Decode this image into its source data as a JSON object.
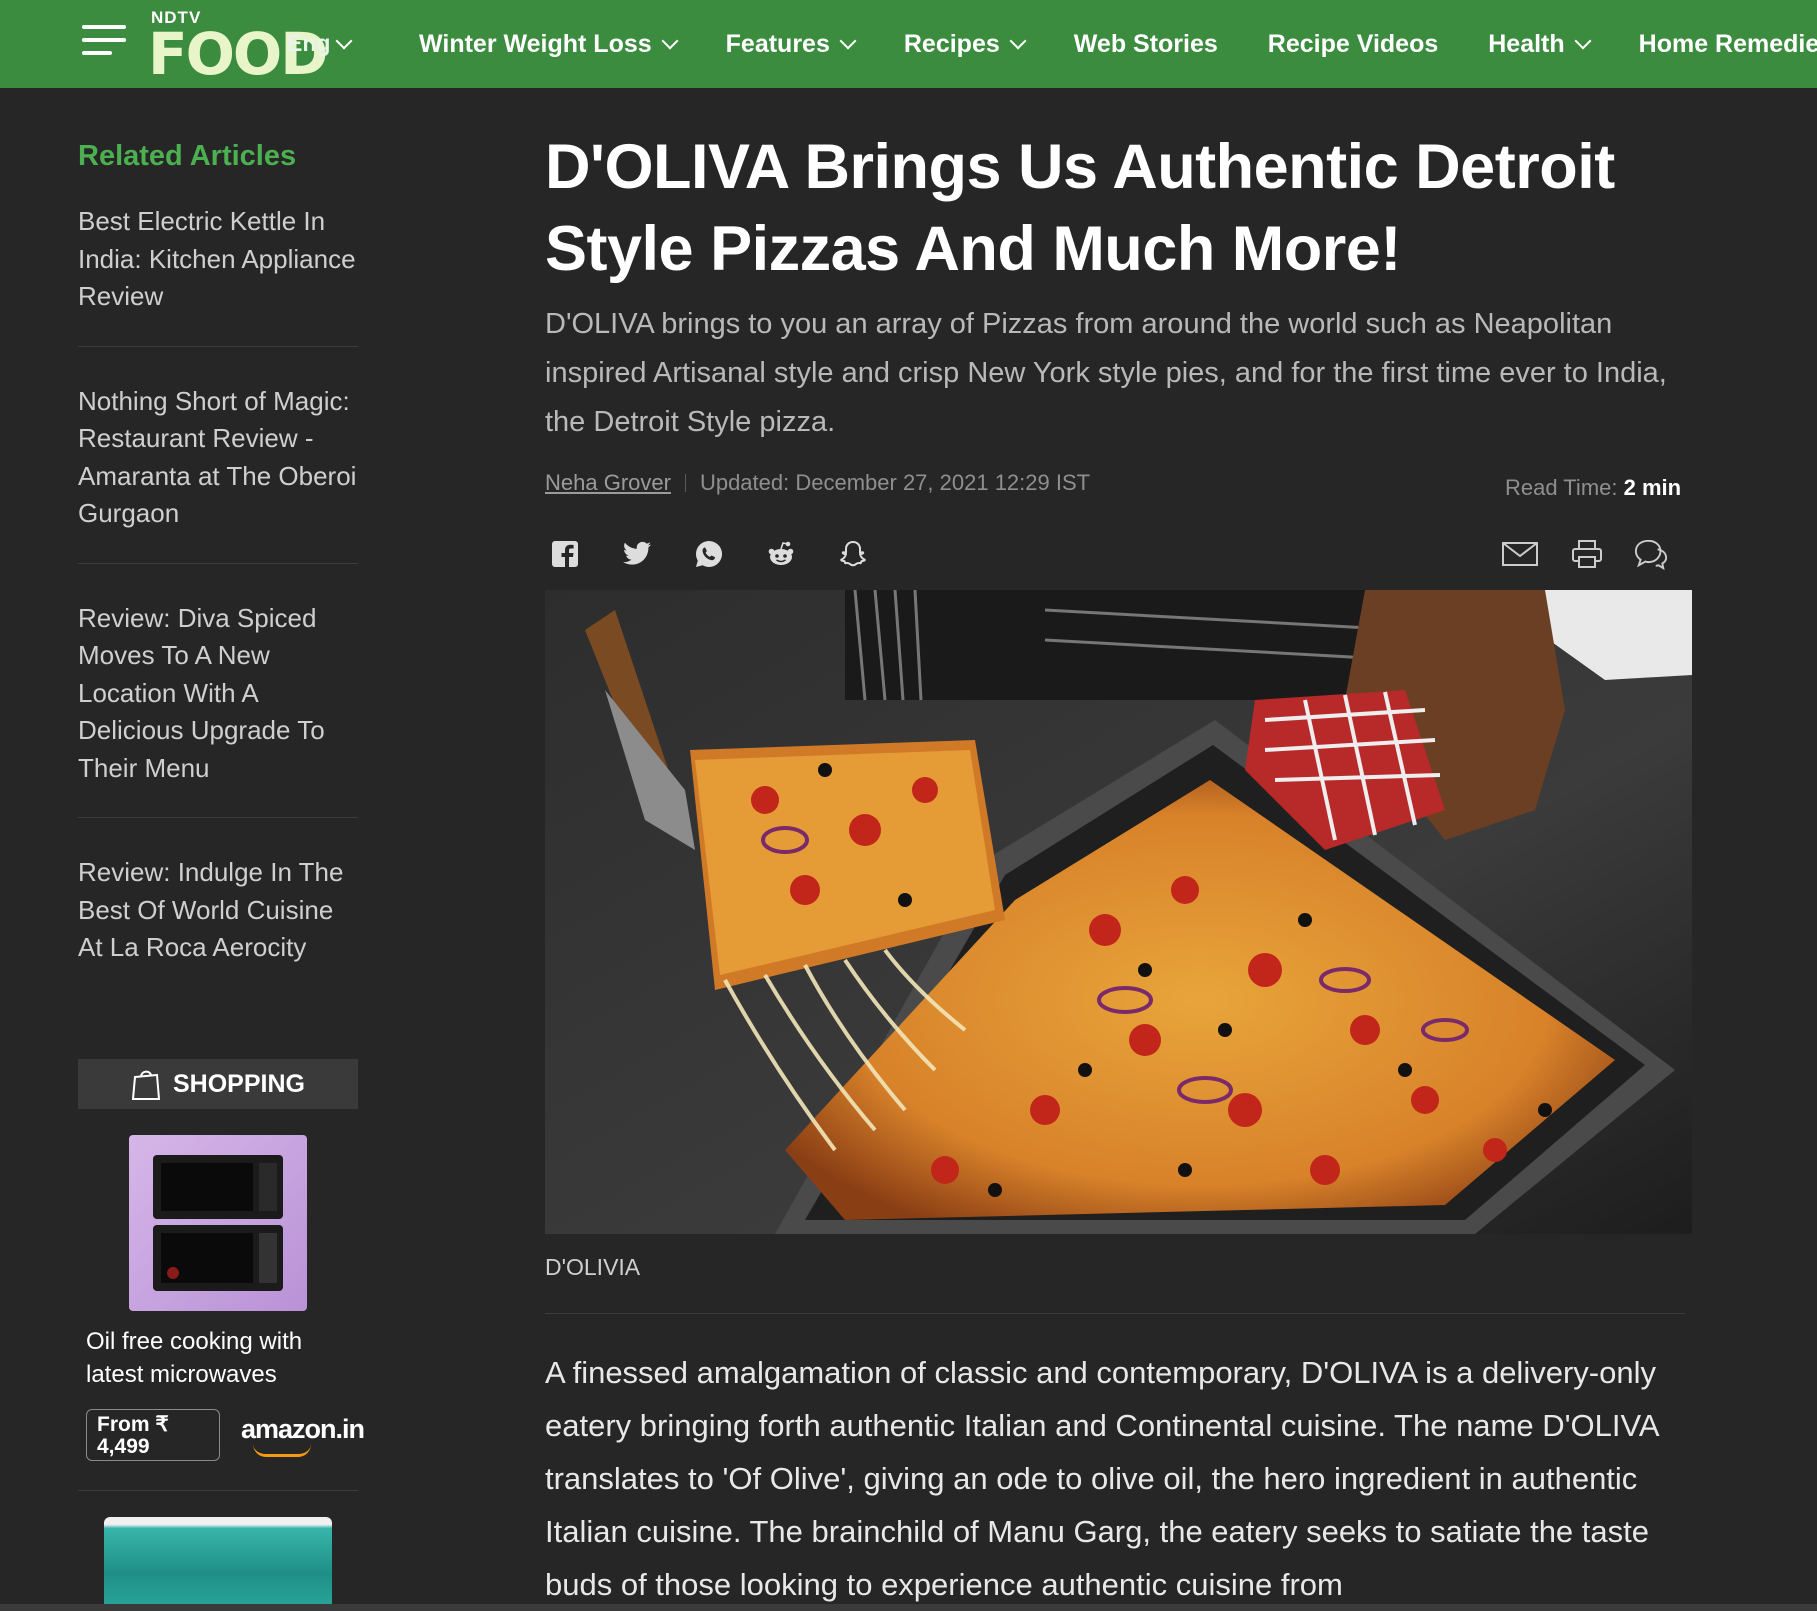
{
  "header": {
    "logo_small": "NDTV",
    "logo_big": "FOOD",
    "language": "Eng",
    "nav": [
      {
        "label": "Winter Weight Loss",
        "dropdown": true
      },
      {
        "label": "Features",
        "dropdown": true
      },
      {
        "label": "Recipes",
        "dropdown": true
      },
      {
        "label": "Web Stories",
        "dropdown": false
      },
      {
        "label": "Recipe Videos",
        "dropdown": false
      },
      {
        "label": "Health",
        "dropdown": true
      },
      {
        "label": "Home Remedies",
        "dropdown": false
      }
    ],
    "bg_color": "#3c8c3f"
  },
  "sidebar": {
    "heading": "Related Articles",
    "heading_color": "#4caf50",
    "items": [
      {
        "label": "Best Electric Kettle In India: Kitchen Appliance Review"
      },
      {
        "label": "Nothing Short of Magic: Restaurant Review - Amaranta at The Oberoi Gurgaon"
      },
      {
        "label": "Review: Diva Spiced Moves To A New Location With A Delicious Upgrade To Their Menu"
      },
      {
        "label": "Review: Indulge In The Best Of World Cuisine At La Roca Aerocity"
      }
    ],
    "shopping": {
      "heading": "SHOPPING",
      "product_title": "Oil free cooking with latest microwaves",
      "price_label": "From ₹",
      "price_value": "4,499",
      "store": "amazon.in"
    }
  },
  "article": {
    "title": "D'OLIVA Brings Us Authentic Detroit Style Pizzas And Much More!",
    "summary": "D'OLIVA brings to you an array of Pizzas from around the world such as Neapolitan inspired Artisanal style and crisp New York style pies, and for the first time ever to India, the Detroit Style pizza.",
    "author": "Neha Grover",
    "updated": "Updated: December 27, 2021 12:29 IST",
    "read_time_label": "Read Time:",
    "read_time_value": "2 min",
    "share_icons": [
      "facebook-icon",
      "twitter-icon",
      "whatsapp-icon",
      "reddit-icon",
      "snapchat-icon"
    ],
    "tool_icons": [
      "email-icon",
      "print-icon",
      "comment-icon"
    ],
    "image_caption": "D'OLIVIA",
    "body": "A finessed amalgamation of classic and contemporary, D'OLIVA is a delivery-only eatery bringing forth authentic Italian and Continental cuisine. The name D'OLIVA translates to 'Of Olive', giving an ode to olive oil, the hero ingredient in authentic Italian cuisine. The brainchild of Manu Garg, the eatery seeks to satiate the taste buds of those looking to experience authentic cuisine from"
  }
}
